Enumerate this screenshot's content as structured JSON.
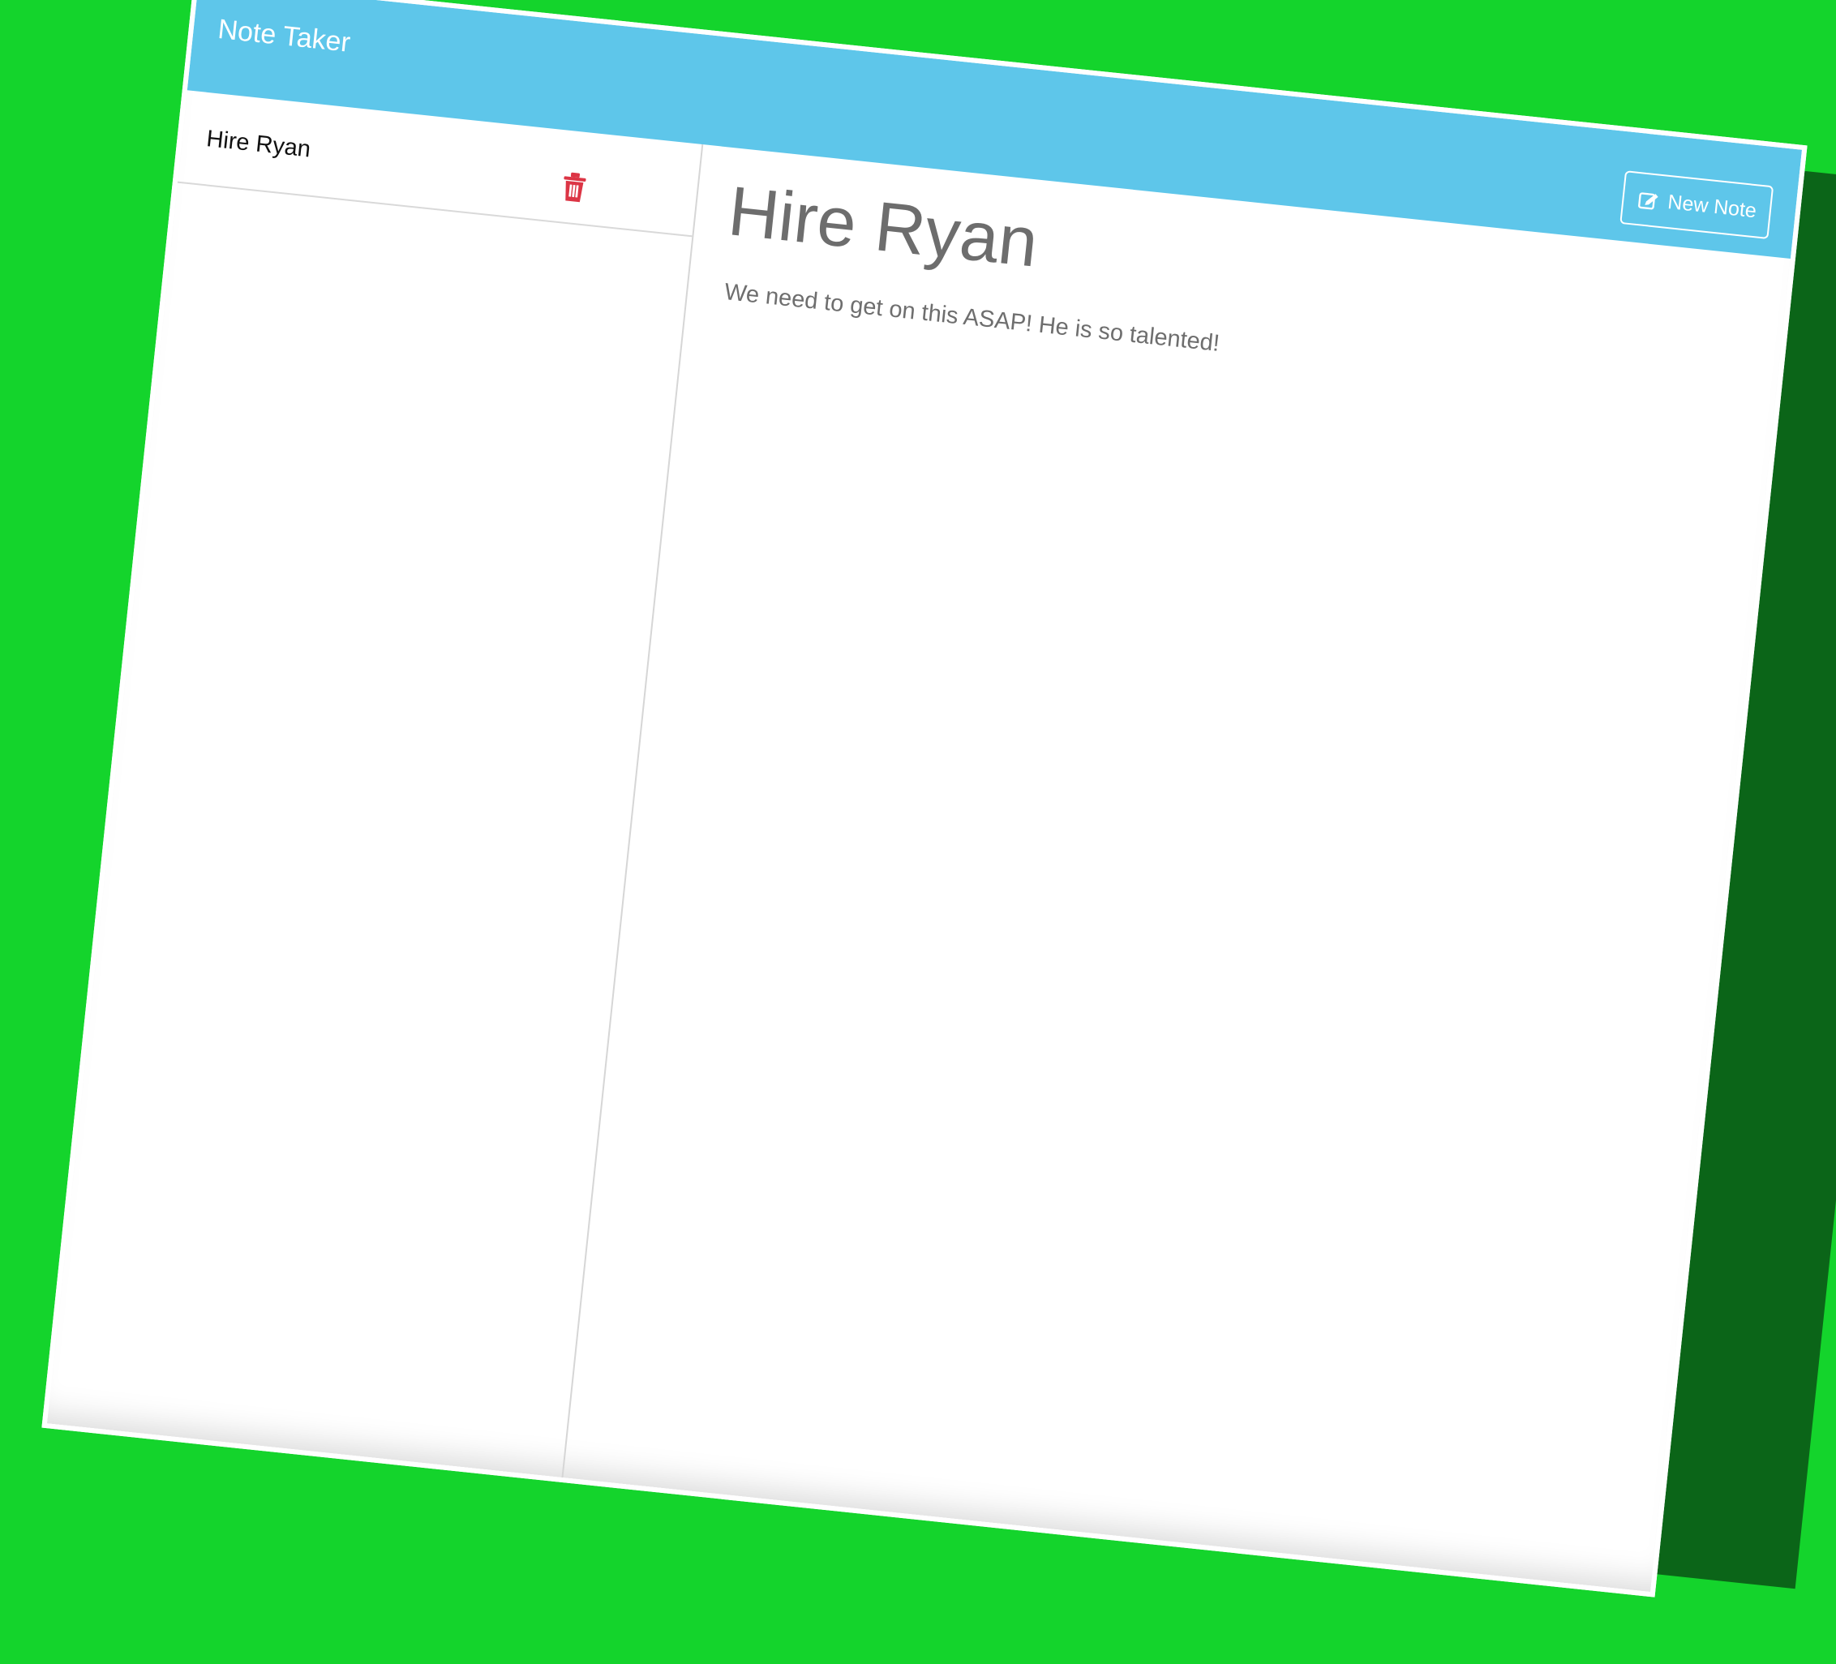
{
  "app": {
    "title": "Note Taker"
  },
  "toolbar": {
    "new_note_label": "New Note",
    "new_note_icon": "pencil-square-icon"
  },
  "sidebar": {
    "items": [
      {
        "title": "Hire Ryan",
        "delete_icon": "trash-icon",
        "delete_color": "#dc3545"
      }
    ]
  },
  "editor": {
    "title": "Hire Ryan",
    "text": "We need to get on this ASAP! He is so talented!"
  },
  "colors": {
    "background": "#14d42c",
    "navbar": "#5ec6ea"
  }
}
